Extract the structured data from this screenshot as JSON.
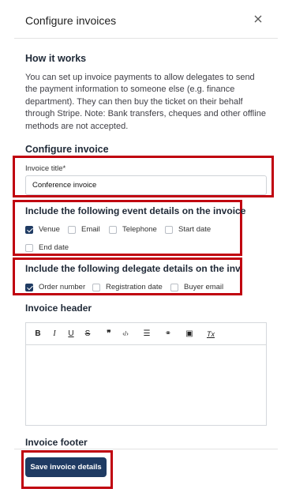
{
  "modal": {
    "title": "Configure invoices"
  },
  "how_it_works": {
    "heading": "How it works",
    "text": "You can set up invoice payments to allow delegates to send the payment information to someone else (e.g. finance department). They can then buy the ticket on their behalf through Stripe.",
    "note": "Note: Bank transfers, cheques and other offline methods are not accepted."
  },
  "configure": {
    "heading": "Configure invoice",
    "title_label": "Invoice title*",
    "title_value": "Conference invoice"
  },
  "event_details": {
    "heading": "Include the following event details on the invoice",
    "options": [
      {
        "label": "Venue",
        "checked": true
      },
      {
        "label": "Email",
        "checked": false
      },
      {
        "label": "Telephone",
        "checked": false
      },
      {
        "label": "Start date",
        "checked": false
      },
      {
        "label": "End date",
        "checked": false
      }
    ]
  },
  "delegate_details": {
    "heading": "Include the following delegate details on the invoice",
    "options": [
      {
        "label": "Order number",
        "checked": true
      },
      {
        "label": "Registration date",
        "checked": false
      },
      {
        "label": "Buyer email",
        "checked": false
      }
    ]
  },
  "header_editor": {
    "heading": "Invoice header",
    "toolbar": [
      {
        "name": "bold-icon",
        "glyph": "B"
      },
      {
        "name": "italic-icon",
        "glyph": "I"
      },
      {
        "name": "underline-icon",
        "glyph": "U"
      },
      {
        "name": "strikethrough-icon",
        "glyph": "S"
      },
      {
        "name": "blockquote-icon",
        "glyph": "❞"
      },
      {
        "name": "code-icon",
        "glyph": "‹/›"
      },
      {
        "name": "align-icon",
        "glyph": "☰"
      },
      {
        "name": "link-icon",
        "glyph": "⚭"
      },
      {
        "name": "image-icon",
        "glyph": "▣"
      },
      {
        "name": "clear-format-icon",
        "glyph": "Tx"
      }
    ]
  },
  "footer": {
    "heading": "Invoice footer",
    "save_label": "Save invoice details"
  },
  "colors": {
    "accent": "#1f3b63",
    "highlight": "#c0000f"
  }
}
